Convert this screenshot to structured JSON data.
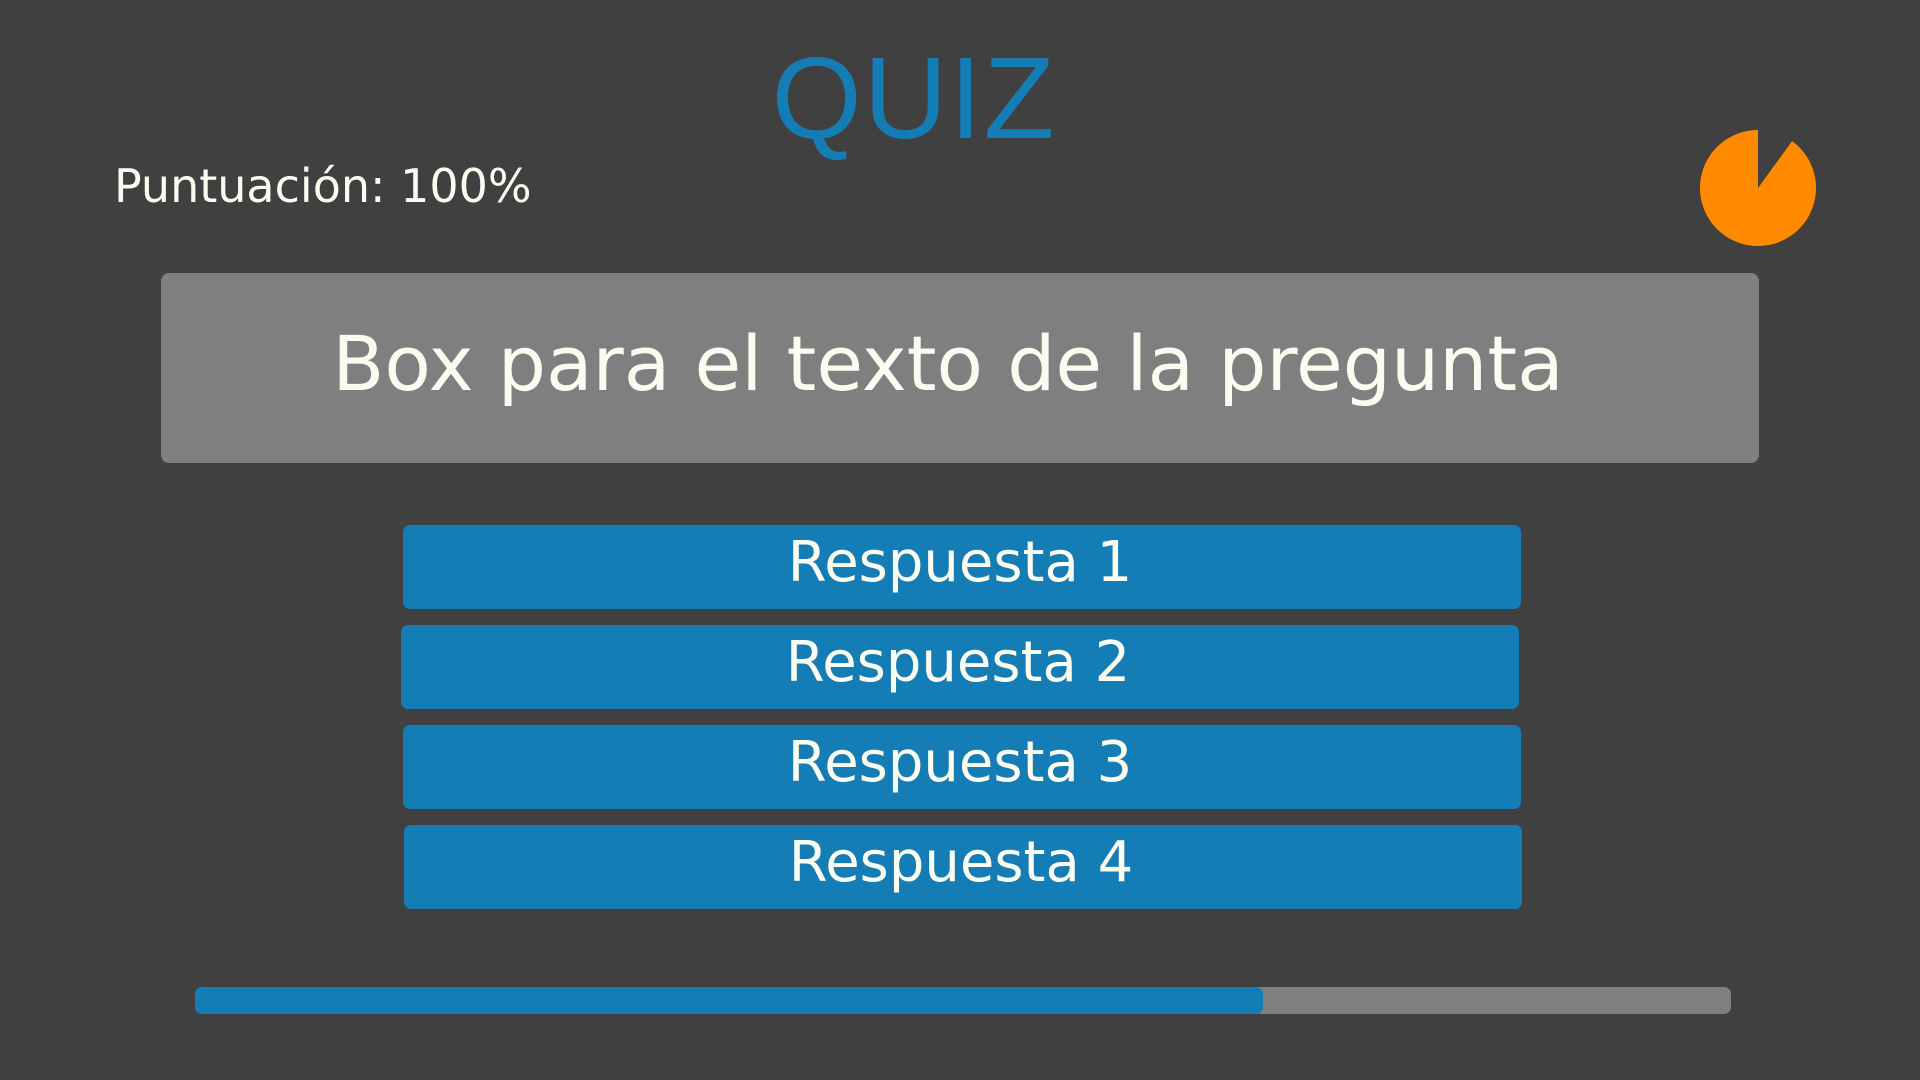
{
  "header": {
    "title": "QUIZ",
    "score_text": "Puntuación: 100%"
  },
  "timer": {
    "icon": "pie-timer-icon",
    "remaining_fraction": 0.9,
    "color": "#FF8A00"
  },
  "question": {
    "text": "Box para el texto de la pregunta"
  },
  "answers": [
    {
      "label": "Respuesta 1"
    },
    {
      "label": "Respuesta 2"
    },
    {
      "label": "Respuesta 3"
    },
    {
      "label": "Respuesta 4"
    }
  ],
  "progress": {
    "fraction": 0.695
  },
  "colors": {
    "background": "#404040",
    "accent": "#157DB5",
    "panel": "#7F7F7F",
    "text": "#FBFCF0",
    "timer": "#FF8A00"
  }
}
